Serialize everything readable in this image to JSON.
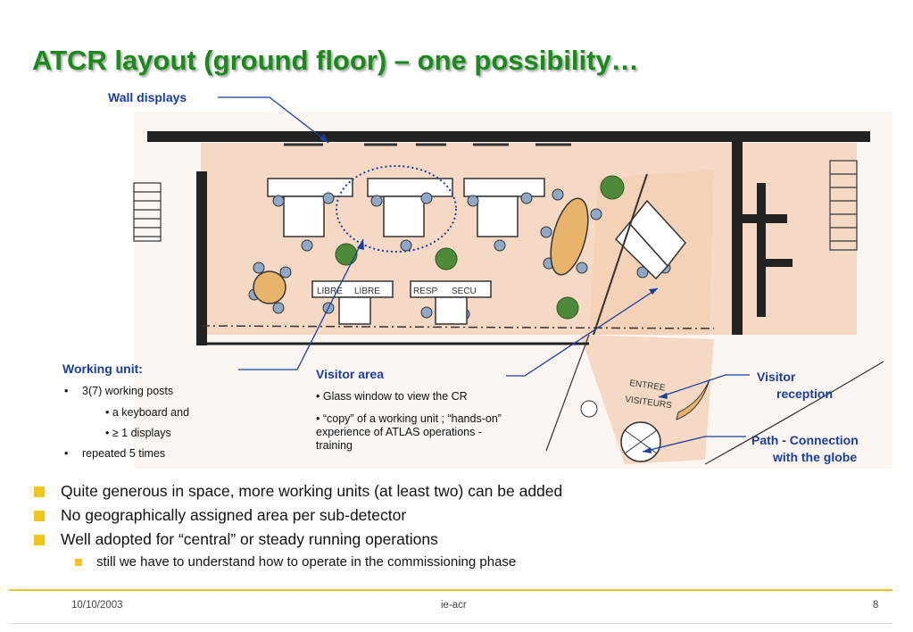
{
  "slide": {
    "title": "ATCR layout (ground floor) – one possibility…"
  },
  "plan_labels": {
    "wall_displays": "Wall displays",
    "working_unit_heading": "Working unit:",
    "working_unit_items": [
      "3(7) working posts",
      "• a keyboard and",
      "• ≥ 1 displays",
      "repeated 5 times"
    ],
    "visitor_area_heading": "Visitor area",
    "visitor_area_items": [
      "• Glass window to view the CR",
      "• “copy” of a working unit ; “hands-on” experience of ATLAS operations - training"
    ],
    "visitor_reception_l1": "Visitor",
    "visitor_reception_l2": "reception",
    "path_l1": "Path - Connection",
    "path_l2": "with the globe"
  },
  "sketch_text": {
    "libre1": "LIBRE",
    "libre2": "LIBRE",
    "resp": "RESP",
    "secu": "SECU",
    "entree": "ENTREE",
    "visiteurs": "VISITEURS"
  },
  "bullets": [
    "Quite generous in space, more working units (at least two) can be added",
    "No geographically assigned area per sub-detector",
    "Well adopted for “central” or steady running operations"
  ],
  "sub_bullets": [
    "still we have to understand how to operate in the commissioning phase"
  ],
  "footer": {
    "date": "10/10/2003",
    "center": "ie-acr",
    "page": "8"
  },
  "colors": {
    "title": "#1a8a1a",
    "label": "#1a3ea0",
    "bullet": "#f0c419",
    "floor": "#f6d9c4"
  }
}
